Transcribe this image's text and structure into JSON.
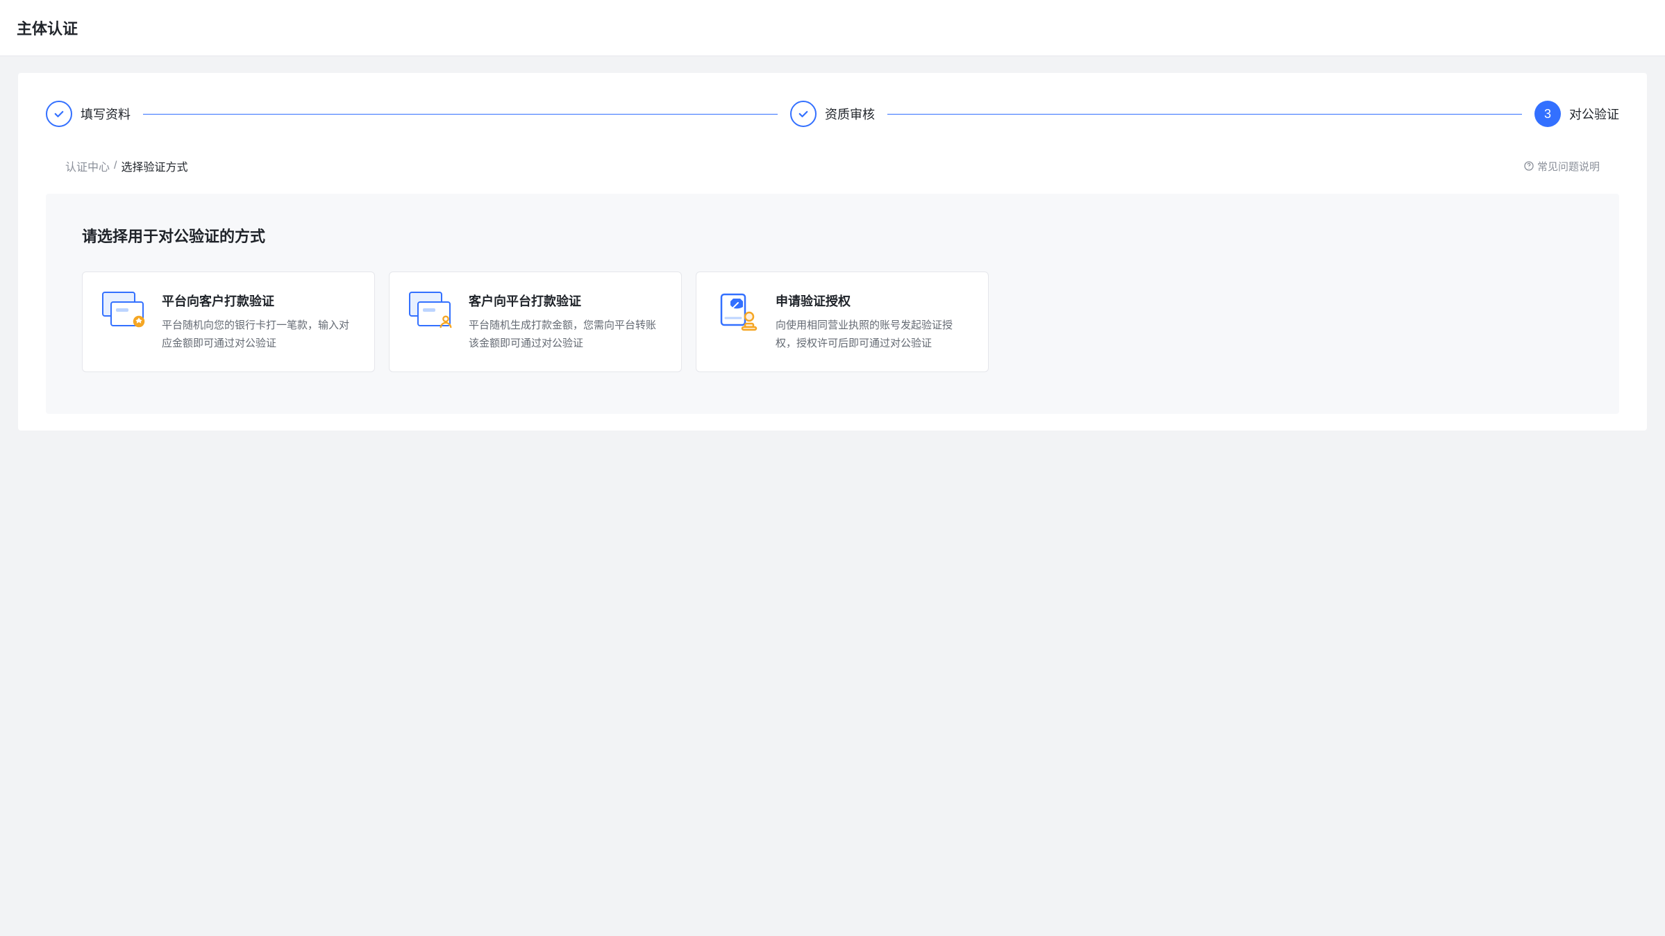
{
  "header": {
    "title": "主体认证"
  },
  "stepper": {
    "step1": {
      "label": "填写资料"
    },
    "step2": {
      "label": "资质审核"
    },
    "step3": {
      "number": "3",
      "label": "对公验证"
    }
  },
  "breadcrumb": {
    "root": "认证中心",
    "sep": "/",
    "current": "选择验证方式"
  },
  "faq": {
    "label": "常见问题说明"
  },
  "section": {
    "title": "请选择用于对公验证的方式"
  },
  "options": {
    "platform_to_customer": {
      "title": "平台向客户打款验证",
      "desc": "平台随机向您的银行卡打一笔款，输入对应金额即可通过对公验证"
    },
    "customer_to_platform": {
      "title": "客户向平台打款验证",
      "desc": "平台随机生成打款金额，您需向平台转账该金额即可通过对公验证"
    },
    "auth_request": {
      "title": "申请验证授权",
      "desc": "向使用相同营业执照的账号发起验证授权，授权许可后即可通过对公验证"
    }
  }
}
